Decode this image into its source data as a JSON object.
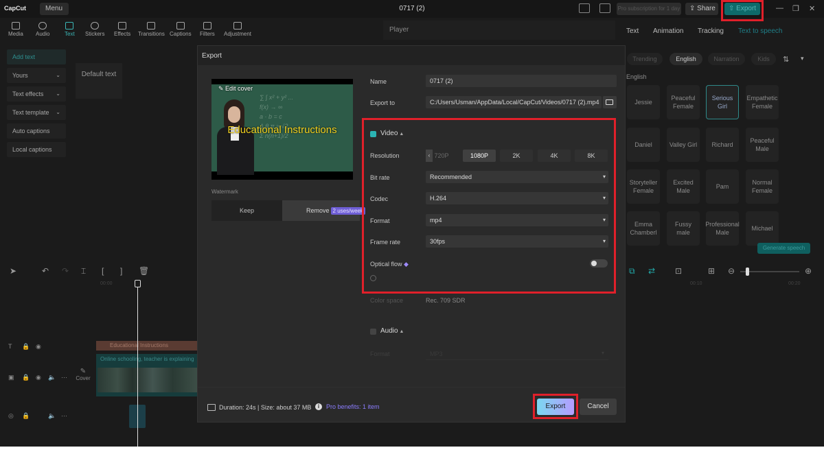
{
  "app": {
    "logo": "CapCut",
    "menu_label": "Menu",
    "project_title": "0717 (2)",
    "pro_promo": "Pro subscription for 1 day",
    "share_label": "Share",
    "export_label": "Export",
    "highlight_color": "#e0202a"
  },
  "toolbar": {
    "tools": [
      "Media",
      "Audio",
      "Text",
      "Stickers",
      "Effects",
      "Transitions",
      "Captions",
      "Filters",
      "Adjustment"
    ],
    "active": "Text"
  },
  "left_panel": {
    "items": [
      "Add text",
      "Yours",
      "Text effects",
      "Text template",
      "Auto captions",
      "Local captions"
    ],
    "default_text_card": "Default text"
  },
  "player": {
    "title": "Player"
  },
  "right_panel": {
    "tabs": [
      "Text",
      "Animation",
      "Tracking",
      "Text to speech"
    ],
    "filters": [
      "Trending",
      "English",
      "Narration",
      "Kids"
    ],
    "language_label": "English",
    "voices": [
      "Jessie",
      "Peaceful Female",
      "Serious Girl",
      "Empathetic Female",
      "Daniel",
      "Valley Girl",
      "Richard",
      "Peaceful Male",
      "Storyteller Female",
      "Excited Male",
      "Pam",
      "Normal Female",
      "Emma Chamberl",
      "Fussy male",
      "Professional Male",
      "Michael"
    ],
    "selected_voice": "Serious Girl",
    "generate_label": "Generate speech"
  },
  "timeline": {
    "ruler_marks": [
      "00:00",
      "00:10",
      "00:20"
    ],
    "text_clip_label": "Educational Instructions",
    "video_clip_label": "Online schooling, teacher is explaining",
    "cover_label": "Cover"
  },
  "export_dialog": {
    "title": "Export",
    "edit_cover": "Edit cover",
    "preview_title": "Educational Instructions",
    "watermark_label": "Watermark",
    "keep_label": "Keep",
    "remove_label": "Remove",
    "remove_badge": "2 uses/week",
    "name_label": "Name",
    "name_value": "0717 (2)",
    "export_to_label": "Export to",
    "export_to_value": "C:/Users/Usman/AppData/Local/CapCut/Videos/0717 (2).mp4",
    "video_section": "Video",
    "video_checked": true,
    "resolution_label": "Resolution",
    "resolution_options": [
      "720P",
      "1080P",
      "2K",
      "4K",
      "8K"
    ],
    "resolution_selected": "1080P",
    "bitrate_label": "Bit rate",
    "bitrate_value": "Recommended",
    "codec_label": "Codec",
    "codec_value": "H.264",
    "format_label": "Format",
    "format_value": "mp4",
    "framerate_label": "Frame rate",
    "framerate_value": "30fps",
    "optical_flow_label": "Optical flow",
    "optical_flow_on": false,
    "color_space_label": "Color space",
    "color_space_value": "Rec. 709 SDR",
    "audio_section": "Audio",
    "audio_checked": false,
    "audio_format_label": "Format",
    "audio_format_value": "MP3",
    "duration_text": "Duration: 24s | Size: about 37 MB",
    "pro_benefits": "Pro benefits: 1 item",
    "export_button": "Export",
    "cancel_button": "Cancel"
  }
}
